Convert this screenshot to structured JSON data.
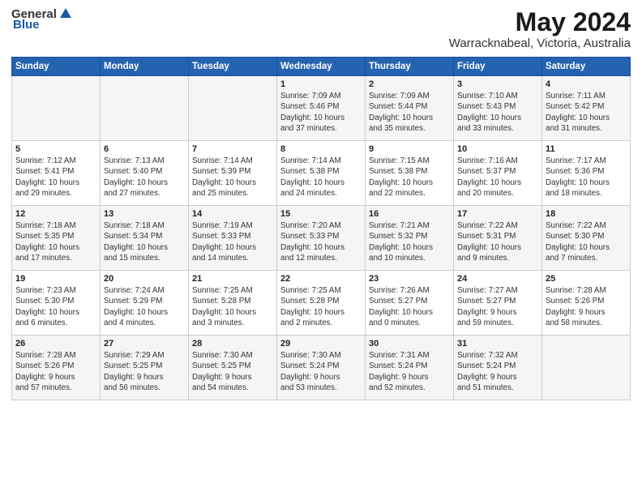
{
  "header": {
    "logo_general": "General",
    "logo_blue": "Blue",
    "title": "May 2024",
    "subtitle": "Warracknabeal, Victoria, Australia"
  },
  "days_of_week": [
    "Sunday",
    "Monday",
    "Tuesday",
    "Wednesday",
    "Thursday",
    "Friday",
    "Saturday"
  ],
  "weeks": [
    [
      {
        "day": "",
        "content": ""
      },
      {
        "day": "",
        "content": ""
      },
      {
        "day": "",
        "content": ""
      },
      {
        "day": "1",
        "content": "Sunrise: 7:09 AM\nSunset: 5:46 PM\nDaylight: 10 hours\nand 37 minutes."
      },
      {
        "day": "2",
        "content": "Sunrise: 7:09 AM\nSunset: 5:44 PM\nDaylight: 10 hours\nand 35 minutes."
      },
      {
        "day": "3",
        "content": "Sunrise: 7:10 AM\nSunset: 5:43 PM\nDaylight: 10 hours\nand 33 minutes."
      },
      {
        "day": "4",
        "content": "Sunrise: 7:11 AM\nSunset: 5:42 PM\nDaylight: 10 hours\nand 31 minutes."
      }
    ],
    [
      {
        "day": "5",
        "content": "Sunrise: 7:12 AM\nSunset: 5:41 PM\nDaylight: 10 hours\nand 29 minutes."
      },
      {
        "day": "6",
        "content": "Sunrise: 7:13 AM\nSunset: 5:40 PM\nDaylight: 10 hours\nand 27 minutes."
      },
      {
        "day": "7",
        "content": "Sunrise: 7:14 AM\nSunset: 5:39 PM\nDaylight: 10 hours\nand 25 minutes."
      },
      {
        "day": "8",
        "content": "Sunrise: 7:14 AM\nSunset: 5:38 PM\nDaylight: 10 hours\nand 24 minutes."
      },
      {
        "day": "9",
        "content": "Sunrise: 7:15 AM\nSunset: 5:38 PM\nDaylight: 10 hours\nand 22 minutes."
      },
      {
        "day": "10",
        "content": "Sunrise: 7:16 AM\nSunset: 5:37 PM\nDaylight: 10 hours\nand 20 minutes."
      },
      {
        "day": "11",
        "content": "Sunrise: 7:17 AM\nSunset: 5:36 PM\nDaylight: 10 hours\nand 18 minutes."
      }
    ],
    [
      {
        "day": "12",
        "content": "Sunrise: 7:18 AM\nSunset: 5:35 PM\nDaylight: 10 hours\nand 17 minutes."
      },
      {
        "day": "13",
        "content": "Sunrise: 7:18 AM\nSunset: 5:34 PM\nDaylight: 10 hours\nand 15 minutes."
      },
      {
        "day": "14",
        "content": "Sunrise: 7:19 AM\nSunset: 5:33 PM\nDaylight: 10 hours\nand 14 minutes."
      },
      {
        "day": "15",
        "content": "Sunrise: 7:20 AM\nSunset: 5:33 PM\nDaylight: 10 hours\nand 12 minutes."
      },
      {
        "day": "16",
        "content": "Sunrise: 7:21 AM\nSunset: 5:32 PM\nDaylight: 10 hours\nand 10 minutes."
      },
      {
        "day": "17",
        "content": "Sunrise: 7:22 AM\nSunset: 5:31 PM\nDaylight: 10 hours\nand 9 minutes."
      },
      {
        "day": "18",
        "content": "Sunrise: 7:22 AM\nSunset: 5:30 PM\nDaylight: 10 hours\nand 7 minutes."
      }
    ],
    [
      {
        "day": "19",
        "content": "Sunrise: 7:23 AM\nSunset: 5:30 PM\nDaylight: 10 hours\nand 6 minutes."
      },
      {
        "day": "20",
        "content": "Sunrise: 7:24 AM\nSunset: 5:29 PM\nDaylight: 10 hours\nand 4 minutes."
      },
      {
        "day": "21",
        "content": "Sunrise: 7:25 AM\nSunset: 5:28 PM\nDaylight: 10 hours\nand 3 minutes."
      },
      {
        "day": "22",
        "content": "Sunrise: 7:25 AM\nSunset: 5:28 PM\nDaylight: 10 hours\nand 2 minutes."
      },
      {
        "day": "23",
        "content": "Sunrise: 7:26 AM\nSunset: 5:27 PM\nDaylight: 10 hours\nand 0 minutes."
      },
      {
        "day": "24",
        "content": "Sunrise: 7:27 AM\nSunset: 5:27 PM\nDaylight: 9 hours\nand 59 minutes."
      },
      {
        "day": "25",
        "content": "Sunrise: 7:28 AM\nSunset: 5:26 PM\nDaylight: 9 hours\nand 58 minutes."
      }
    ],
    [
      {
        "day": "26",
        "content": "Sunrise: 7:28 AM\nSunset: 5:26 PM\nDaylight: 9 hours\nand 57 minutes."
      },
      {
        "day": "27",
        "content": "Sunrise: 7:29 AM\nSunset: 5:25 PM\nDaylight: 9 hours\nand 56 minutes."
      },
      {
        "day": "28",
        "content": "Sunrise: 7:30 AM\nSunset: 5:25 PM\nDaylight: 9 hours\nand 54 minutes."
      },
      {
        "day": "29",
        "content": "Sunrise: 7:30 AM\nSunset: 5:24 PM\nDaylight: 9 hours\nand 53 minutes."
      },
      {
        "day": "30",
        "content": "Sunrise: 7:31 AM\nSunset: 5:24 PM\nDaylight: 9 hours\nand 52 minutes."
      },
      {
        "day": "31",
        "content": "Sunrise: 7:32 AM\nSunset: 5:24 PM\nDaylight: 9 hours\nand 51 minutes."
      },
      {
        "day": "",
        "content": ""
      }
    ]
  ]
}
